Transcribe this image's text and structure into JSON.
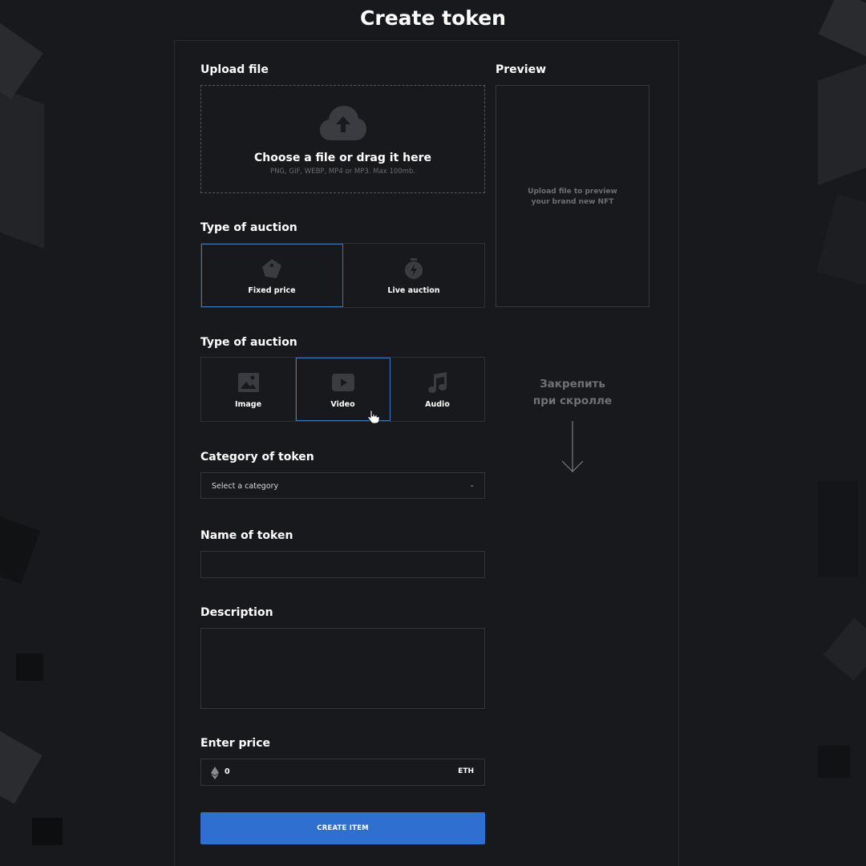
{
  "page": {
    "title": "Create token"
  },
  "upload": {
    "label": "Upload file",
    "title": "Choose a file or drag it here",
    "hint": "PNG, GIF, WEBP, MP4 or MP3. Max 100mb."
  },
  "preview": {
    "label": "Preview",
    "placeholder": "Upload file to preview\nyour brand new NFT"
  },
  "auction": {
    "label": "Type of auction",
    "options": [
      {
        "label": "Fixed price",
        "icon": "price-tag-icon",
        "selected": true
      },
      {
        "label": "Live auction",
        "icon": "stopwatch-icon",
        "selected": false
      }
    ]
  },
  "media": {
    "label": "Type of auction",
    "options": [
      {
        "label": "Image",
        "icon": "image-icon",
        "selected": false
      },
      {
        "label": "Video",
        "icon": "video-play-icon",
        "selected": true
      },
      {
        "label": "Audio",
        "icon": "music-note-icon",
        "selected": false
      }
    ]
  },
  "pin_hint": {
    "text": "Закрепить\nпри скролле"
  },
  "category": {
    "label": "Category of token",
    "value": "Select a category"
  },
  "name": {
    "label": "Name of token",
    "value": ""
  },
  "description": {
    "label": "Description",
    "value": ""
  },
  "price": {
    "label": "Enter price",
    "value": "0",
    "unit": "ETH"
  },
  "actions": {
    "create_label": "CREATE ITEM"
  },
  "colors": {
    "accent": "#2f6fd0",
    "selected_border": "#3b76b8",
    "background": "#18191c"
  }
}
